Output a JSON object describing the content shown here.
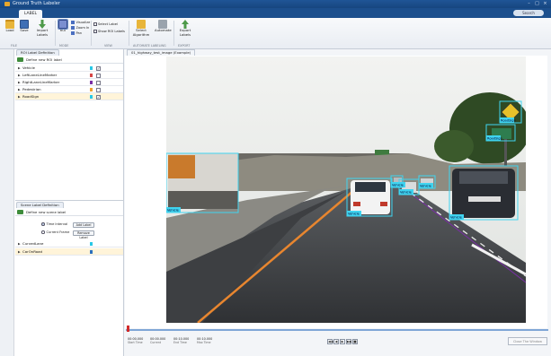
{
  "window": {
    "title": "Ground Truth Labeler",
    "controls": [
      "–",
      "□",
      "×"
    ]
  },
  "ribbon_tab": "LABEL",
  "help_chip": "Search Documentation",
  "toolstrip": {
    "tools": [
      {
        "label": "Load",
        "icon": "folder-icon"
      },
      {
        "label": "Save",
        "icon": "save-icon"
      },
      {
        "label": "Import\nLabels",
        "icon": "import-icon"
      },
      {
        "label": "ROI",
        "icon": "roi-icon"
      },
      {
        "label": "Select\nAlgorithm",
        "icon": "select-algorithm-icon"
      },
      {
        "label": "Automate",
        "icon": "automate-icon"
      },
      {
        "label": "Export\nLabels",
        "icon": "export-icon"
      }
    ],
    "options": {
      "visualize": "Visualize",
      "zoom_in": "Zoom In",
      "pan": "Pan",
      "select_attribute": "Select Label",
      "show_roi_labels": "Show ROI Labels"
    },
    "sections": [
      "FILE",
      "MODE",
      "VIEW",
      "AUTOMATE LABELING",
      "EXPORT"
    ]
  },
  "left_panel": {
    "roi_tab": "ROI Label Definition",
    "roi_tool": "Define new ROI label",
    "roi_labels": [
      {
        "name": "Vehicle",
        "color": "#28c8e6",
        "checked": true
      },
      {
        "name": "LeftLaneLineMarker",
        "color": "#d64545",
        "checked": false
      },
      {
        "name": "RightLaneLineMarker",
        "color": "#7a2ea6",
        "checked": false
      },
      {
        "name": "Pedestrian",
        "color": "#f0a030",
        "checked": false
      },
      {
        "name": "RoadSign",
        "color": "#28c8e6",
        "checked": true
      }
    ],
    "scene_tab": "Scene Label Definition",
    "scene_tool": "Define new scene label",
    "radio_time": "Time Interval",
    "radio_frame": "Current Frame",
    "add_label_btn": "Add Label",
    "remove_label_btn": "Remove Label",
    "scene_labels": [
      {
        "name": "CurvedLane",
        "color": "#28c8e6"
      },
      {
        "name": "CarOnRoad",
        "color": "#2a6fbd"
      }
    ]
  },
  "image_tab": "01_highway_test_image (Example)",
  "boxes": [
    {
      "label": "Vehicle"
    },
    {
      "label": "Vehicle"
    },
    {
      "label": "Vehicle"
    },
    {
      "label": "Vehicle"
    },
    {
      "label": "Vehicle"
    },
    {
      "label": "Vehicle"
    },
    {
      "label": "RoadSign"
    },
    {
      "label": "RoadSign"
    }
  ],
  "timeline": {
    "fields": [
      {
        "value": "00:00.000",
        "caption": "Start Time"
      },
      {
        "value": "00:00.000",
        "caption": "Current"
      },
      {
        "value": "00:10.000",
        "caption": "End Time"
      },
      {
        "value": "00:10.000",
        "caption": "Max Time"
      }
    ],
    "play_controls": [
      "◀◀",
      "◀",
      "▶",
      "▶▶",
      "■"
    ],
    "close_review": "Close The Window"
  }
}
